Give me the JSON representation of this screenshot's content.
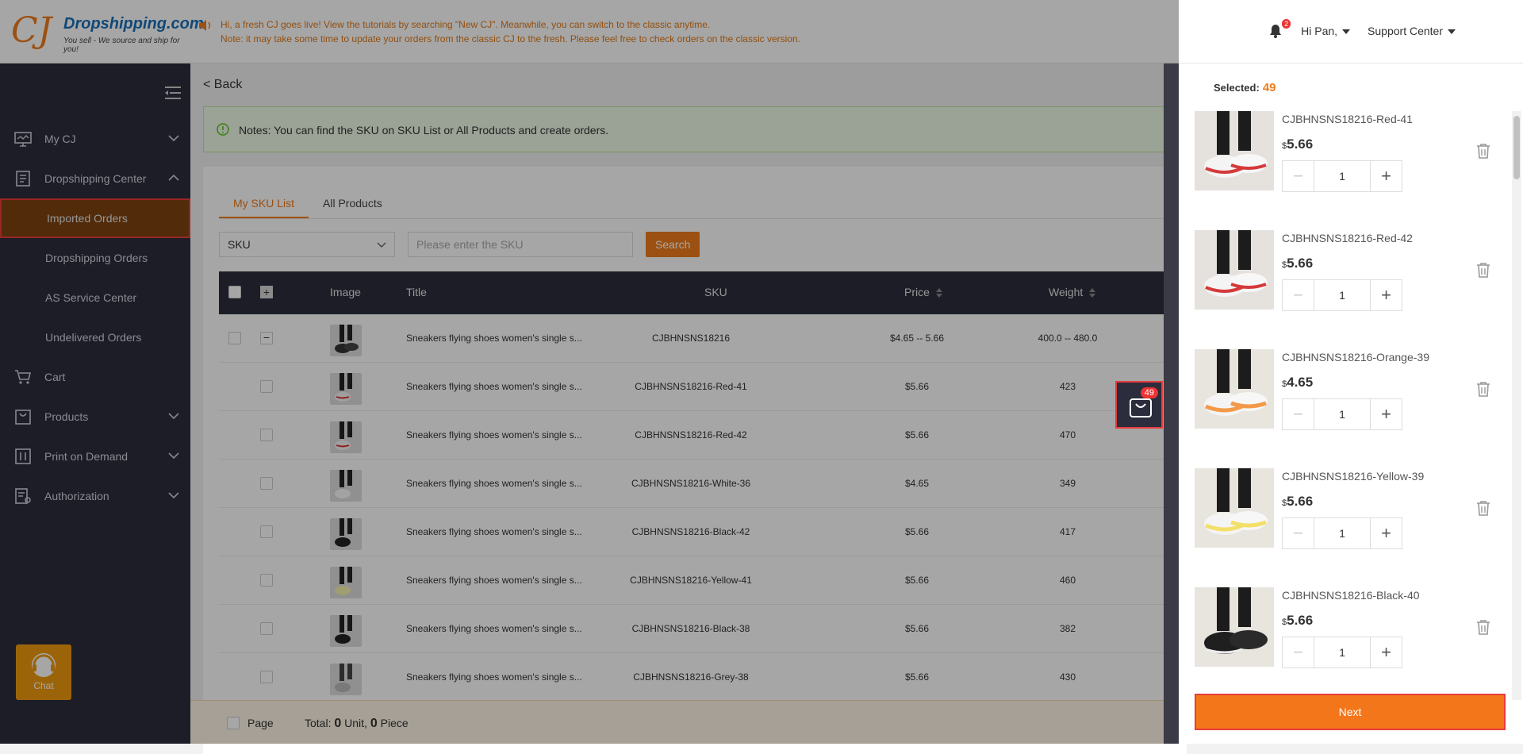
{
  "header": {
    "logo_cj": "CJ",
    "logo_brand": "Dropshipping.com",
    "logo_tagline": "You sell - We source and ship for you!",
    "notice_line1": "Hi, a fresh CJ goes live! View the tutorials by searching \"New CJ\". Meanwhile, you can switch to the classic anytime.",
    "notice_line2": "Note: it may take some time to update your orders from the classic CJ to the fresh. Please feel free to check orders on the classic version.",
    "notification_count": "2",
    "user_label": "Hi Pan,",
    "support_label": "Support Center"
  },
  "sidebar": {
    "items": [
      {
        "label": "My CJ",
        "icon": "monitor-icon"
      },
      {
        "label": "Dropshipping Center",
        "icon": "clipboard-icon"
      },
      {
        "label": "Imported Orders"
      },
      {
        "label": "Dropshipping Orders"
      },
      {
        "label": "AS Service Center"
      },
      {
        "label": "Undelivered Orders"
      },
      {
        "label": "Cart",
        "icon": "cart-icon"
      },
      {
        "label": "Products",
        "icon": "bag-icon"
      },
      {
        "label": "Print on Demand",
        "icon": "print-icon"
      },
      {
        "label": "Authorization",
        "icon": "authorization-icon"
      }
    ],
    "chat_label": "Chat"
  },
  "main": {
    "back_label": "< Back",
    "alert_text": "Notes: You can find the SKU on SKU List or All Products and create orders.",
    "tabs": [
      "My SKU List",
      "All Products"
    ],
    "filter": {
      "select_value": "SKU",
      "search_placeholder": "Please enter the SKU",
      "search_button": "Search"
    },
    "columns": {
      "image": "Image",
      "title": "Title",
      "sku": "SKU",
      "price": "Price",
      "weight": "Weight"
    },
    "rows": [
      {
        "title": "Sneakers flying shoes women's single s...",
        "sku": "CJBHNSNS18216",
        "price": "$4.65 -- 5.66",
        "weight": "400.0 -- 480.0"
      },
      {
        "title": "Sneakers flying shoes women's single s...",
        "sku": "CJBHNSNS18216-Red-41",
        "price": "$5.66",
        "weight": "423"
      },
      {
        "title": "Sneakers flying shoes women's single s...",
        "sku": "CJBHNSNS18216-Red-42",
        "price": "$5.66",
        "weight": "470"
      },
      {
        "title": "Sneakers flying shoes women's single s...",
        "sku": "CJBHNSNS18216-White-36",
        "price": "$4.65",
        "weight": "349"
      },
      {
        "title": "Sneakers flying shoes women's single s...",
        "sku": "CJBHNSNS18216-Black-42",
        "price": "$5.66",
        "weight": "417"
      },
      {
        "title": "Sneakers flying shoes women's single s...",
        "sku": "CJBHNSNS18216-Yellow-41",
        "price": "$5.66",
        "weight": "460"
      },
      {
        "title": "Sneakers flying shoes women's single s...",
        "sku": "CJBHNSNS18216-Black-38",
        "price": "$5.66",
        "weight": "382"
      },
      {
        "title": "Sneakers flying shoes women's single s...",
        "sku": "CJBHNSNS18216-Grey-38",
        "price": "$5.66",
        "weight": "430"
      }
    ],
    "footer": {
      "page_label": "Page",
      "total_label": "Total:",
      "units": "0",
      "unit_label": "Unit,",
      "pieces": "0",
      "piece_label": "Piece"
    }
  },
  "cart_badge": "49",
  "drawer": {
    "selected_label": "Selected:",
    "selected_count": "49",
    "items": [
      {
        "name": "CJBHNSNS18216-Red-41",
        "currency": "$",
        "price": "5.66",
        "qty": "1"
      },
      {
        "name": "CJBHNSNS18216-Red-42",
        "currency": "$",
        "price": "5.66",
        "qty": "1"
      },
      {
        "name": "CJBHNSNS18216-Orange-39",
        "currency": "$",
        "price": "4.65",
        "qty": "1"
      },
      {
        "name": "CJBHNSNS18216-Yellow-39",
        "currency": "$",
        "price": "5.66",
        "qty": "1"
      },
      {
        "name": "CJBHNSNS18216-Black-40",
        "currency": "$",
        "price": "5.66",
        "qty": "1"
      }
    ],
    "next_label": "Next"
  },
  "colors": {
    "accent": "#f07c1b",
    "sidebar_bg": "#2b2d3c",
    "highlight_border": "#e83b3b",
    "alert_bg": "#eef9e6"
  }
}
